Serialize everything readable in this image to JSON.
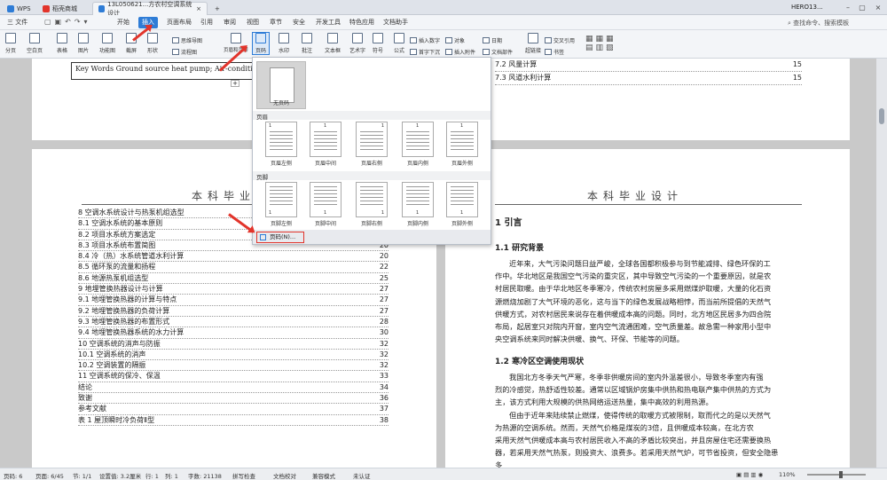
{
  "titlebar": {
    "wps": "WPS",
    "tab1": "稻壳商城",
    "tab2": "13L050621...方农村空调系统设计",
    "user": "HERO13..."
  },
  "menubar": {
    "file": "三 文件",
    "items": [
      "开始",
      "插入",
      "页面布局",
      "引用",
      "审阅",
      "视图",
      "章节",
      "安全",
      "开发工具",
      "特色应用",
      "文档助手"
    ],
    "search": "查找命令、搜索模板"
  },
  "ribbon": {
    "items": [
      "分页",
      "空白页",
      "表格",
      "图片",
      "功能图",
      "截屏",
      "形状",
      "思维导图",
      "流程图",
      "页眉和页脚",
      "页码",
      "水印",
      "批注",
      "文本框",
      "艺术字",
      "符号",
      "公式",
      "插入数字",
      "首字下沉",
      "对象",
      "插入附件",
      "日期",
      "文档部件",
      "超链接",
      "书签",
      "交叉引用"
    ]
  },
  "page1": {
    "keywords": "Key Words   Ground source heat pump; Air-conditionin"
  },
  "toc_right": [
    {
      "t": "7.2 风量计算",
      "p": "15"
    },
    {
      "t": "7.3 风道水利计算",
      "p": "15"
    }
  ],
  "heading": "本科毕业设计",
  "toc": [
    {
      "t": "8  空调水系统设计与热泵机组选型",
      "p": ""
    },
    {
      "t": "8.1  空调水系统的基本原则",
      "p": ""
    },
    {
      "t": "8.2  项目水系统方案选定",
      "p": ""
    },
    {
      "t": "8.3  项目水系统布置简图",
      "p": "20"
    },
    {
      "t": "8.4  冷（热）水系统管道水利计算",
      "p": "20"
    },
    {
      "t": "8.5  循环泵的流量和扬程",
      "p": "22"
    },
    {
      "t": "8.6  地源热泵机组选型",
      "p": "25"
    },
    {
      "t": "9  地埋管换热器设计与计算",
      "p": "27"
    },
    {
      "t": "9.1  地埋管换热器的计算与特点",
      "p": "27"
    },
    {
      "t": "9.2  地埋管换热器的负荷计算",
      "p": "27"
    },
    {
      "t": "9.3  地埋管换热器的布置形式",
      "p": "28"
    },
    {
      "t": "9.4  地埋管换热器系统的水力计算",
      "p": "30"
    },
    {
      "t": "10  空调系统的消声与防振",
      "p": "32"
    },
    {
      "t": "10.1  空调系统的消声",
      "p": "32"
    },
    {
      "t": "10.2  空调装置的隔振",
      "p": "32"
    },
    {
      "t": "11  空调系统的保冷、保温",
      "p": "33"
    },
    {
      "t": "结论",
      "p": "34"
    },
    {
      "t": "致谢",
      "p": "36"
    },
    {
      "t": "参考文献",
      "p": "37"
    },
    {
      "t": "表 1  屋顶瞬时冷负荷Ⅱ型",
      "p": "38"
    }
  ],
  "right": {
    "h1": "1  引言",
    "h11": "1.1  研究背景",
    "p1": [
      "近年来，大气污染问题日益严峻，全球各国都积极参与到节能减排、绿色环保的工",
      "作中。华北地区是我国空气污染的重灾区，其中导致空气污染的一个重要原因，就是农",
      "村居民取暖。由于华北地区冬季寒冷，传统农村房屋多采用燃煤炉取暖，大量的化石资",
      "源燃烧加剧了大气环境的恶化，这与当下的绿色发展战略相悖，而当前所提倡的天然气",
      "供暖方式，对农村居民来说存在着供暖成本高的问题。同时，北方地区民居多为四合院",
      "布局，起居室只对院内开窗，室内空气流通困难，空气质量差。故急需一种家用小型中",
      "央空调系统来同时解决供暖、换气、环保、节能等的问题。"
    ],
    "h12": "1.2  寒冷区空调使用现状",
    "p2": [
      "我国北方冬季天气严寒，冬季非供暖房间的室内外温差很小，导致冬季室内有强",
      "烈的冷感觉，热舒适性较差。通常以区域锅炉房集中供热和热电联产集中供热的方式为",
      "主，该方式利用大规模的供热网络运送热量，集中高效的利用热源。",
      "但由于近年来陆续禁止燃煤，使得传统的取暖方式被限制，取而代之的是以天然气",
      "为热源的空调系统。然而，天然气价格是煤炭的3倍，且供暖成本较高，在北方农",
      "采用天然气供暖成本高与农村居民收入不高的矛盾比较突出，并且房屋住宅还需要换热",
      "器，若采用天然气热泵，则投资大、浪费多。若采用天然气炉，可节省投资，但安全隐患",
      "多"
    ]
  },
  "dropdown": {
    "none": "无页码",
    "sec_header": "页眉",
    "header_items": [
      "页眉左侧",
      "页眉中间",
      "页眉右侧",
      "页眉内侧",
      "页眉外侧"
    ],
    "sec_footer": "页脚",
    "footer_items": [
      "页脚左侧",
      "页脚中间",
      "页脚右侧",
      "页脚内侧",
      "页脚外侧"
    ],
    "more": "页码(N)..."
  },
  "status": {
    "page": "页码: 6",
    "pages": "页面: 6/45",
    "section": "节: 1/1",
    "setting": "设置值: 3.2厘米",
    "row": "行: 1",
    "col": "列: 1",
    "words": "字数: 21138",
    "spell": "拼写检查",
    "proof": "文档校对",
    "compat": "兼容模式",
    "cert": "未认证",
    "zoom": "110%"
  }
}
